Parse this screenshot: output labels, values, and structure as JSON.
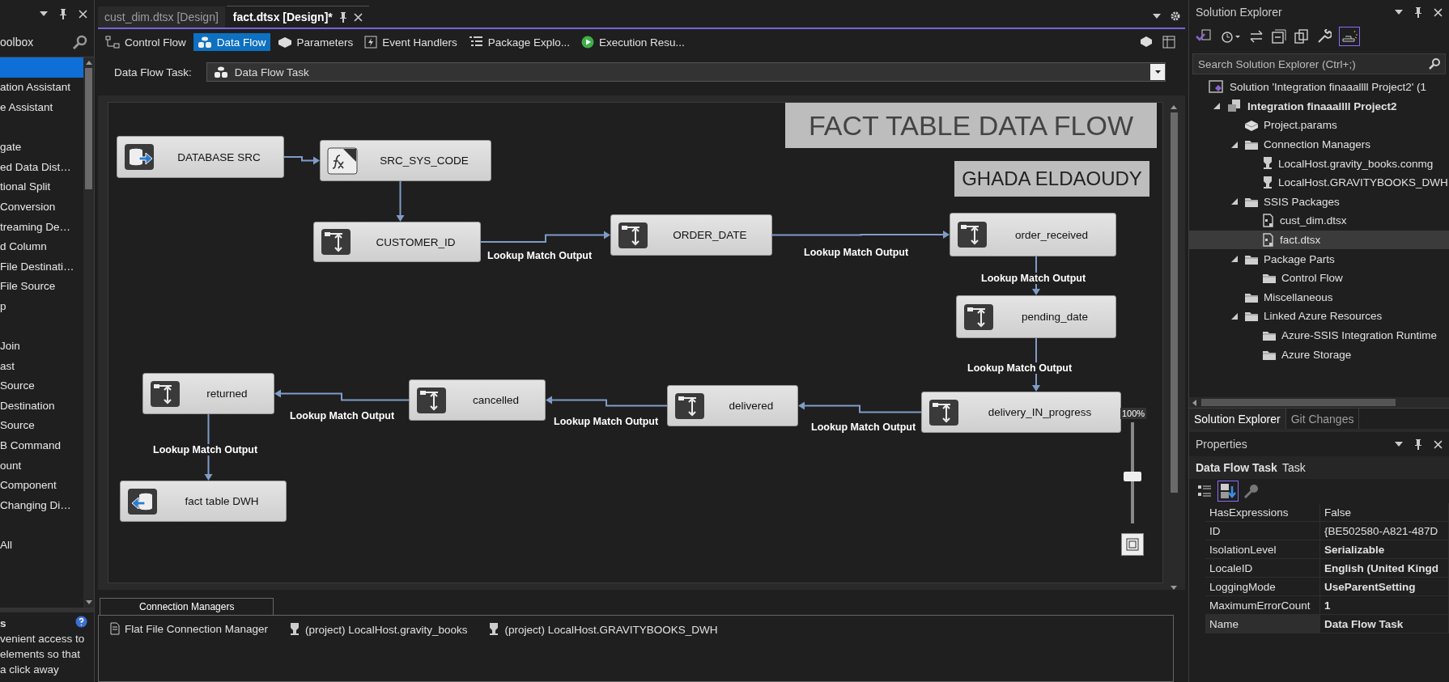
{
  "toolbox": {
    "title": "oolbox",
    "items": [
      {
        "selected": true
      },
      {
        "label": "ation Assistant",
        "selected": false
      },
      {
        "label": "e Assistant",
        "selected": false
      },
      {
        "selected": false
      },
      {
        "label": "gate",
        "selected": false
      },
      {
        "label": "ed Data Dist…",
        "selected": false
      },
      {
        "label": "tional Split",
        "selected": false
      },
      {
        "label": "Conversion",
        "selected": false
      },
      {
        "label": "treaming De…",
        "selected": false
      },
      {
        "label": "d Column",
        "selected": false
      },
      {
        "label": "File Destinati…",
        "selected": false
      },
      {
        "label": "File Source",
        "selected": false
      },
      {
        "label": "p",
        "selected": false
      },
      {
        "selected": false
      },
      {
        "label": "Join",
        "selected": false
      },
      {
        "label": "ast",
        "selected": false
      },
      {
        "label": "Source",
        "selected": false
      },
      {
        "label": "Destination",
        "selected": false
      },
      {
        "label": "Source",
        "selected": false
      },
      {
        "label": "B Command",
        "selected": false
      },
      {
        "label": "ount",
        "selected": false
      },
      {
        "label": "Component",
        "selected": false
      },
      {
        "label": "Changing Di…",
        "selected": false
      },
      {
        "selected": false
      },
      {
        "label": "All",
        "selected": false
      }
    ],
    "info": {
      "title": "s",
      "lines": [
        "venient access to",
        "elements so that",
        "a click away"
      ]
    }
  },
  "document_tabs": [
    {
      "label": "cust_dim.dtsx [Design]",
      "selected": false
    },
    {
      "label": "fact.dtsx [Design]*",
      "selected": true
    }
  ],
  "designer_tabs": [
    {
      "label": "Control Flow",
      "kind": "control",
      "selected": false
    },
    {
      "label": "Data Flow",
      "kind": "dataflow",
      "selected": true
    },
    {
      "label": "Parameters",
      "kind": "params",
      "selected": false
    },
    {
      "label": "Event Handlers",
      "kind": "events",
      "selected": false
    },
    {
      "label": "Package Explo...",
      "kind": "explorer",
      "selected": false
    },
    {
      "label": "Execution Resu...",
      "kind": "play",
      "selected": false
    }
  ],
  "task_selector": {
    "label": "Data Flow Task:",
    "value": "Data Flow Task"
  },
  "canvas": {
    "title": "FACT TABLE DATA FLOW",
    "author": "GHADA ELDAOUDY",
    "nodes": [
      {
        "label": "DATABASE SRC",
        "kind": "source"
      },
      {
        "label": "SRC_SYS_CODE",
        "kind": "script"
      },
      {
        "label": "CUSTOMER_ID",
        "kind": "lookup"
      },
      {
        "label": "ORDER_DATE",
        "kind": "lookup"
      },
      {
        "label": "order_received",
        "kind": "lookup"
      },
      {
        "label": "pending_date",
        "kind": "lookup"
      },
      {
        "label": "delivery_IN_progress",
        "kind": "lookup"
      },
      {
        "label": "delivered",
        "kind": "lookup"
      },
      {
        "label": "cancelled",
        "kind": "lookup"
      },
      {
        "label": "returned",
        "kind": "lookup"
      },
      {
        "label": "fact table DWH",
        "kind": "destination"
      }
    ],
    "edges": [
      {
        "kind": "path"
      },
      {
        "kind": "path"
      },
      {
        "kind": "output",
        "label": "Lookup Match Output"
      },
      {
        "kind": "output",
        "label": "Lookup Match Output"
      },
      {
        "kind": "output",
        "label": "Lookup Match Output"
      },
      {
        "kind": "output",
        "label": "Lookup Match Output"
      },
      {
        "kind": "output",
        "label": "Lookup Match Output"
      },
      {
        "kind": "output",
        "label": "Lookup Match Output"
      },
      {
        "kind": "output",
        "label": "Lookup Match Output"
      },
      {
        "kind": "output",
        "label": "Lookup Match Output"
      }
    ],
    "zoom": {
      "reading": "100%",
      "level": 0.46
    }
  },
  "connection_managers": {
    "title": "Connection Managers",
    "items": [
      {
        "label": "Flat File Connection Manager",
        "kind": "file"
      },
      {
        "label": "(project) LocalHost.gravity_books",
        "kind": "db"
      },
      {
        "label": "(project) LocalHost.GRAVITYBOOKS_DWH",
        "kind": "db"
      }
    ]
  },
  "solution_explorer": {
    "title": "Solution Explorer",
    "search": {
      "placeholder": "Search Solution Explorer (Ctrl+;)"
    },
    "tree": [
      {
        "label": "Solution 'Integration finaaallll Project2' (1",
        "kind": "solution",
        "selected": false,
        "children": [
          {
            "label": "Integration finaaallll Project2",
            "kind": "project",
            "expanded": true,
            "selected": false,
            "children": [
              {
                "label": "Project.params",
                "kind": "params",
                "selected": false
              },
              {
                "label": "Connection Managers",
                "kind": "folder",
                "expanded": true,
                "selected": false,
                "children": [
                  {
                    "label": "LocalHost.gravity_books.conmg",
                    "kind": "connection",
                    "selected": false
                  },
                  {
                    "label": "LocalHost.GRAVITYBOOKS_DWH",
                    "kind": "connection",
                    "selected": false
                  }
                ]
              },
              {
                "label": "SSIS Packages",
                "kind": "folder",
                "expanded": true,
                "selected": false,
                "children": [
                  {
                    "label": "cust_dim.dtsx",
                    "kind": "package",
                    "selected": false
                  },
                  {
                    "label": "fact.dtsx",
                    "kind": "package",
                    "selected": true
                  }
                ]
              },
              {
                "label": "Package Parts",
                "kind": "folder",
                "expanded": true,
                "selected": false,
                "children": [
                  {
                    "label": "Control Flow",
                    "kind": "folder",
                    "selected": false
                  }
                ]
              },
              {
                "label": "Miscellaneous",
                "kind": "folder",
                "selected": false
              },
              {
                "label": "Linked Azure Resources",
                "kind": "folder",
                "expanded": true,
                "selected": false,
                "children": [
                  {
                    "label": "Azure-SSIS Integration Runtime",
                    "kind": "folder",
                    "selected": false
                  },
                  {
                    "label": "Azure Storage",
                    "kind": "folder",
                    "selected": false
                  }
                ]
              }
            ]
          }
        ]
      }
    ],
    "tabs": [
      {
        "label": "Solution Explorer",
        "selected": true
      },
      {
        "label": "Git Changes",
        "selected": false
      }
    ]
  },
  "properties": {
    "title": "Properties",
    "object": {
      "name": "Data Flow Task",
      "type": "Task"
    },
    "toolbar": [
      {
        "kind": "categorized",
        "selected": false
      },
      {
        "kind": "alphabetical",
        "selected": true
      },
      {
        "kind": "property_pages",
        "selected": false
      }
    ],
    "rows": [
      {
        "name": "HasExpressions",
        "value": "False",
        "modified": false,
        "selected": false
      },
      {
        "name": "ID",
        "value": "{BE502580-A821-487D",
        "modified": false,
        "selected": false
      },
      {
        "name": "IsolationLevel",
        "value": "Serializable",
        "modified": true,
        "selected": false
      },
      {
        "name": "LocaleID",
        "value": "English (United Kingd",
        "modified": true,
        "selected": false
      },
      {
        "name": "LoggingMode",
        "value": "UseParentSetting",
        "modified": true,
        "selected": false
      },
      {
        "name": "MaximumErrorCount",
        "value": "1",
        "modified": true,
        "selected": false
      },
      {
        "name": "Name",
        "value": "Data Flow Task",
        "modified": true,
        "selected": true
      }
    ]
  }
}
